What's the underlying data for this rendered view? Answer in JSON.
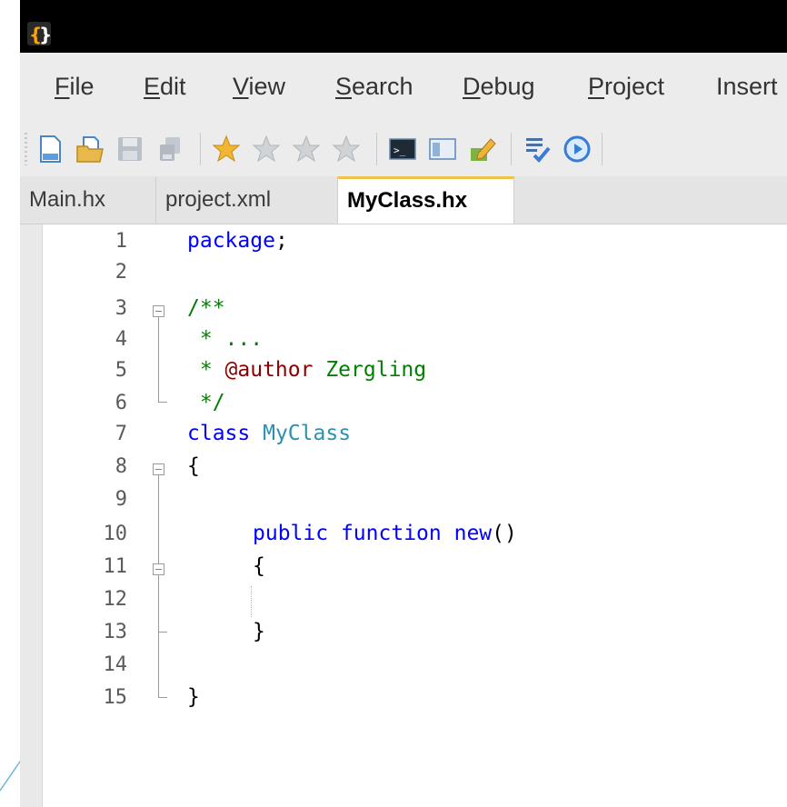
{
  "menu": [
    {
      "mnemonic": "F",
      "rest": "ile"
    },
    {
      "mnemonic": "E",
      "rest": "dit"
    },
    {
      "mnemonic": "V",
      "rest": "iew"
    },
    {
      "mnemonic": "S",
      "rest": "earch"
    },
    {
      "mnemonic": "D",
      "rest": "ebug"
    },
    {
      "mnemonic": "P",
      "rest": "roject"
    },
    {
      "mnemonic": "",
      "rest": "Insert"
    }
  ],
  "toolbar_icons": [
    "new-file-icon",
    "open-file-icon",
    "save-icon",
    "save-all-icon",
    "bookmark-star-icon",
    "star-icon",
    "star-icon",
    "star-icon",
    "terminal-icon",
    "panel-icon",
    "edit-pencil-icon",
    "tasks-icon",
    "run-icon"
  ],
  "tabs": [
    {
      "label": "Main.hx",
      "active": false
    },
    {
      "label": "project.xml",
      "active": false
    },
    {
      "label": "MyClass.hx",
      "active": true
    }
  ],
  "code": {
    "line_numbers": [
      "1",
      "2",
      "3",
      "4",
      "5",
      "6",
      "7",
      "8",
      "9",
      "10",
      "11",
      "12",
      "13",
      "14",
      "15"
    ],
    "l1_keyword": "package",
    "l1_rest": ";",
    "l3": "/**",
    "l4": " * ...",
    "l5_star": " * ",
    "l5_tag": "@author",
    "l5_name": " Zergling",
    "l6": " */",
    "l7_keyword": "class",
    "l7_name": "MyClass",
    "l8": "{",
    "l10_public": "public",
    "l10_function": "function",
    "l10_new": "new",
    "l10_parens": "()",
    "l11": "{",
    "l13": "}",
    "l15": "}"
  },
  "colors": {
    "keyword": "#0000ff",
    "type_name": "#2b91af",
    "comment": "#008000",
    "doc_tag": "#8b0000",
    "plain": "#000000",
    "tab_accent": "#f0c24b"
  }
}
